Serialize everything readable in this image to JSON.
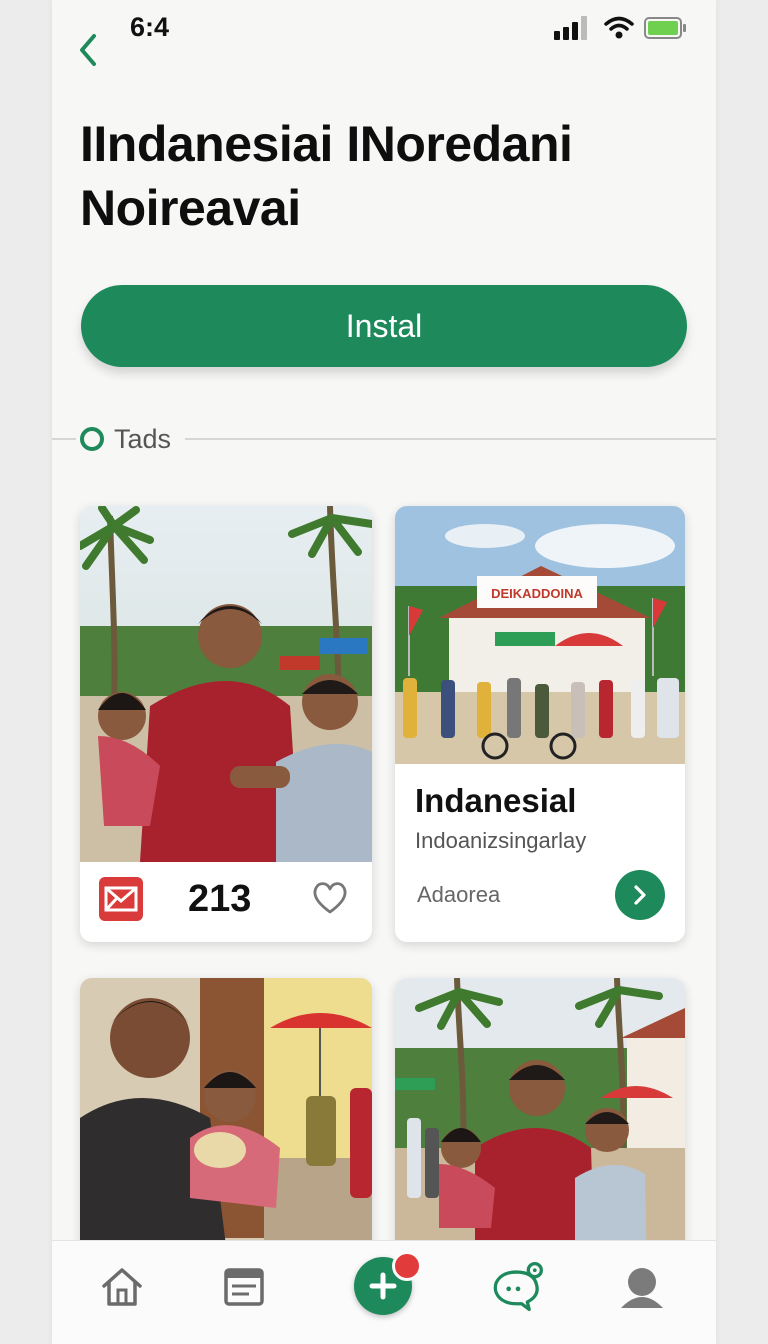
{
  "status_bar": {
    "time": "6:4"
  },
  "page": {
    "title": "IIndanesiai INoredani Noireavai"
  },
  "install": {
    "label": "Instal"
  },
  "section": {
    "label": "Tads"
  },
  "cards": [
    {
      "count": "213"
    },
    {
      "title": "Indanesial",
      "subtitle": "Indoanizsingarlay",
      "meta": "Adaorea",
      "sign_text": "DEIKADDOINA"
    },
    {},
    {}
  ],
  "colors": {
    "accent": "#1e8a5c",
    "badge": "#e23b3b",
    "mail": "#d93a3a"
  },
  "icons": {
    "back": "chevron-left-icon",
    "signal": "signal-icon",
    "wifi": "wifi-icon",
    "battery": "battery-icon",
    "mail": "mail-icon",
    "heart": "heart-icon",
    "go": "chevron-right-icon",
    "home": "home-icon",
    "list": "card-icon",
    "add": "plus-icon",
    "chat": "chat-icon",
    "profile": "profile-icon"
  }
}
